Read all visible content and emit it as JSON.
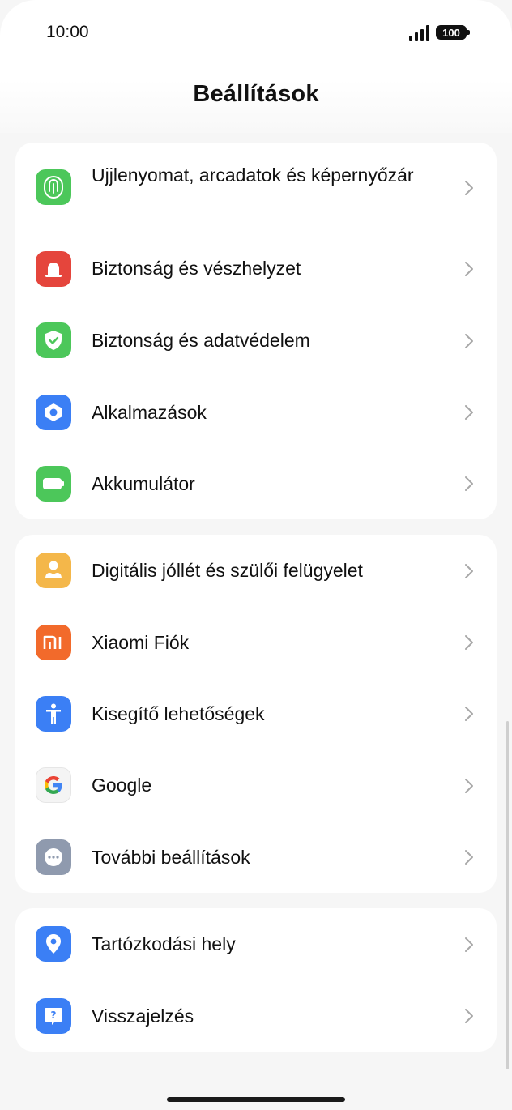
{
  "status": {
    "time": "10:00",
    "battery": "100"
  },
  "header": {
    "title": "Beállítások"
  },
  "groups": [
    {
      "items": [
        {
          "label": "Ujjlenyomat, arcadatok és képernyőzár",
          "icon": "fingerprint-icon",
          "color": "#4cc75a"
        },
        {
          "label": "Biztonság és vészhelyzet",
          "icon": "siren-icon",
          "color": "#e5453c"
        },
        {
          "label": "Biztonság és adatvédelem",
          "icon": "shield-check-icon",
          "color": "#4cc75a"
        },
        {
          "label": "Alkalmazások",
          "icon": "apps-hexagon-icon",
          "color": "#3b7ff5"
        },
        {
          "label": "Akkumulátor",
          "icon": "battery-icon",
          "color": "#4cc75a"
        }
      ]
    },
    {
      "items": [
        {
          "label": "Digitális jóllét és szülői felügyelet",
          "icon": "wellbeing-icon",
          "color": "#f4b74a"
        },
        {
          "label": "Xiaomi Fiók",
          "icon": "mi-logo-icon",
          "color": "#f26a2b"
        },
        {
          "label": "Kisegítő lehetőségek",
          "icon": "accessibility-icon",
          "color": "#3b7ff5"
        },
        {
          "label": "Google",
          "icon": "google-icon",
          "color": "#f4f4f4"
        },
        {
          "label": "További beállítások",
          "icon": "more-dots-icon",
          "color": "#8f9aae"
        }
      ]
    },
    {
      "items": [
        {
          "label": "Tartózkodási hely",
          "icon": "location-pin-icon",
          "color": "#3b7ff5"
        },
        {
          "label": "Visszajelzés",
          "icon": "feedback-icon",
          "color": "#3b7ff5"
        }
      ]
    }
  ]
}
